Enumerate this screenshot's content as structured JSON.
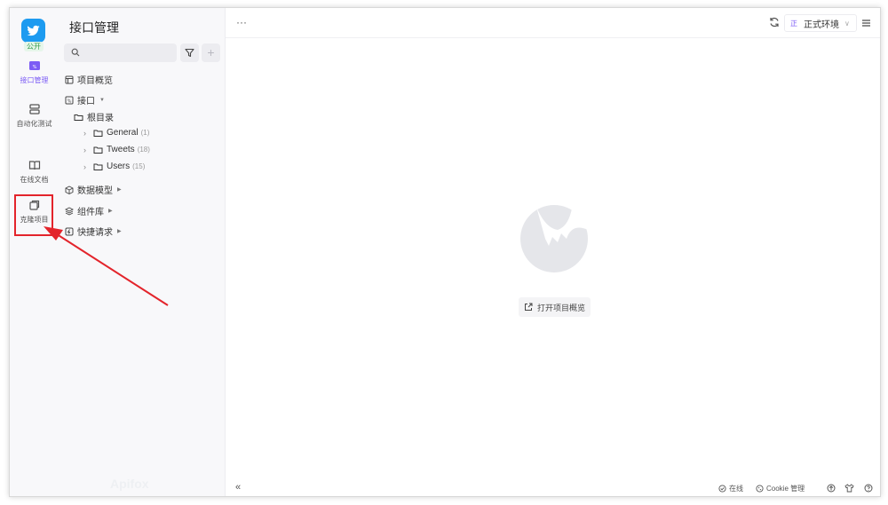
{
  "rail": {
    "public_badge": "公开",
    "items": [
      {
        "label": "接口管理",
        "icon": "api-icon"
      },
      {
        "label": "自动化测试",
        "icon": "layers-icon"
      },
      {
        "label": "在线文档",
        "icon": "book-icon"
      },
      {
        "label": "克隆项目",
        "icon": "copy-icon"
      }
    ]
  },
  "panel": {
    "title": "接口管理",
    "search_placeholder": "",
    "add_label": "+",
    "tree": {
      "overview": "项目概览",
      "api": "接口",
      "root": "根目录",
      "folders": [
        {
          "name": "General",
          "count": "(1)"
        },
        {
          "name": "Tweets",
          "count": "(18)"
        },
        {
          "name": "Users",
          "count": "(15)"
        }
      ],
      "data_model": "数据模型",
      "components": "组件库",
      "quick_request": "快捷请求"
    },
    "watermark": "Apifox"
  },
  "main": {
    "more": "···",
    "env_badge": "正",
    "env_name": "正式环境",
    "open_overview": "打开项目概览"
  },
  "statusbar": {
    "collapse": "«",
    "online": "在线",
    "cookie": "Cookie 管理"
  },
  "colors": {
    "accent": "#7c5cf5",
    "brand": "#1d9bf0",
    "highlight": "#e3242b",
    "public_green": "#2f9b4a"
  }
}
